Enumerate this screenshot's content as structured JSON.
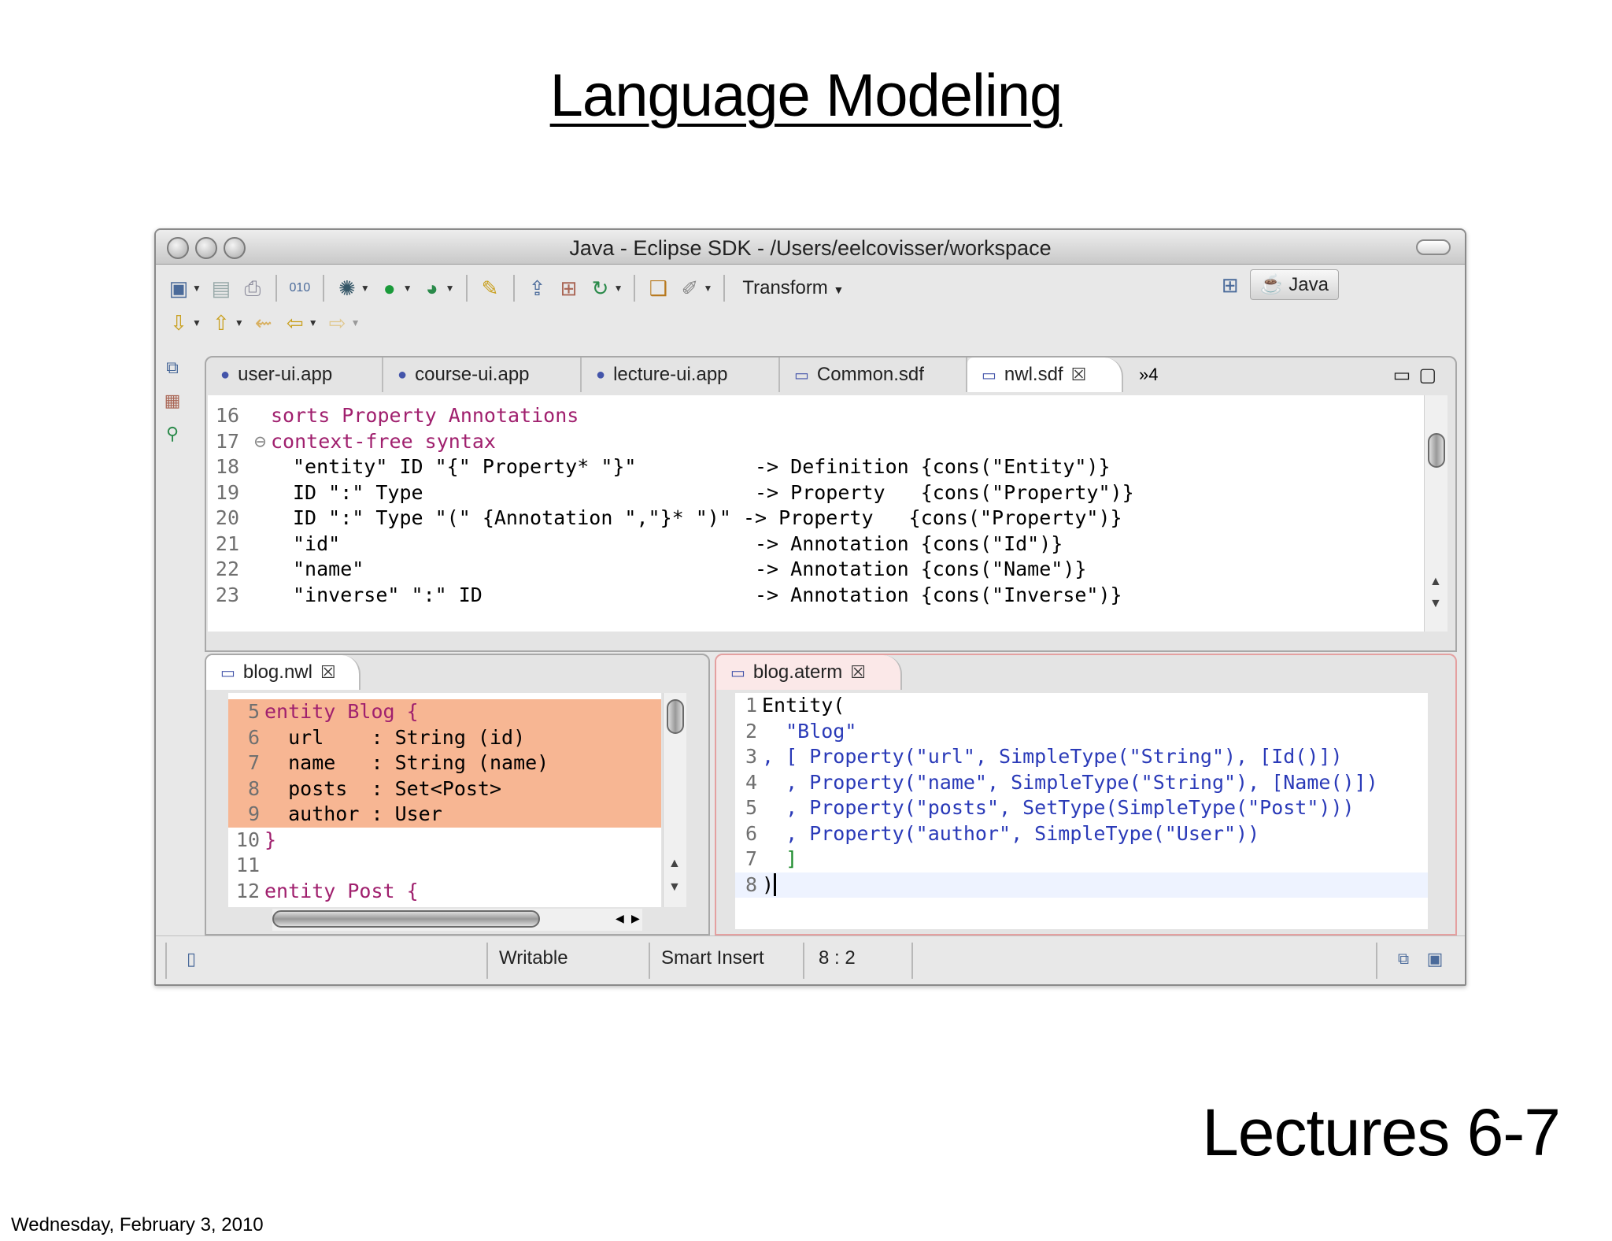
{
  "slide": {
    "title": "Language Modeling",
    "footer": "Lectures 6-7",
    "date": "Wednesday, February 3, 2010"
  },
  "window": {
    "title": "Java - Eclipse SDK - /Users/eelcovisser/workspace"
  },
  "toolbar": {
    "transform_label": "Transform",
    "perspective_label": "Java"
  },
  "top_editor": {
    "tabs": [
      {
        "label": "user-ui.app",
        "icon": "app-file-icon"
      },
      {
        "label": "course-ui.app",
        "icon": "app-file-icon"
      },
      {
        "label": "lecture-ui.app",
        "icon": "app-file-icon"
      },
      {
        "label": "Common.sdf",
        "icon": "sdf-file-icon"
      },
      {
        "label": "nwl.sdf",
        "icon": "sdf-file-icon"
      }
    ],
    "overflow": "»4",
    "lines": [
      {
        "n": "16",
        "text": "sorts Property Annotations"
      },
      {
        "n": "17",
        "text": "context-free syntax"
      },
      {
        "n": "18",
        "text": "\"entity\" ID \"{\" Property* \"}\"          -> Definition {cons(\"Entity\")}"
      },
      {
        "n": "19",
        "text": "ID \":\" Type                            -> Property   {cons(\"Property\")}"
      },
      {
        "n": "20",
        "text": "ID \":\" Type \"(\" {Annotation \",\"}* \")\" -> Property   {cons(\"Property\")}"
      },
      {
        "n": "21",
        "text": "\"id\"                                   -> Annotation {cons(\"Id\")}"
      },
      {
        "n": "22",
        "text": "\"name\"                                 -> Annotation {cons(\"Name\")}"
      },
      {
        "n": "23",
        "text": "\"inverse\" \":\" ID                       -> Annotation {cons(\"Inverse\")}"
      }
    ]
  },
  "left_editor": {
    "tab": "blog.nwl",
    "lines": [
      {
        "n": "5",
        "text": "entity Blog {"
      },
      {
        "n": "6",
        "text": "  url    : String (id)"
      },
      {
        "n": "7",
        "text": "  name   : String (name)"
      },
      {
        "n": "8",
        "text": "  posts  : Set<Post>"
      },
      {
        "n": "9",
        "text": "  author : User"
      },
      {
        "n": "10",
        "text": "}"
      },
      {
        "n": "11",
        "text": ""
      },
      {
        "n": "12",
        "text": "entity Post {"
      }
    ]
  },
  "right_editor": {
    "tab": "blog.aterm",
    "lines": [
      {
        "n": "1",
        "text": "Entity("
      },
      {
        "n": "2",
        "text": "  \"Blog\""
      },
      {
        "n": "3",
        "text": ", [ Property(\"url\", SimpleType(\"String\"), [Id()])"
      },
      {
        "n": "4",
        "text": "  , Property(\"name\", SimpleType(\"String\"), [Name()])"
      },
      {
        "n": "5",
        "text": "  , Property(\"posts\", SetType(SimpleType(\"Post\")))"
      },
      {
        "n": "6",
        "text": "  , Property(\"author\", SimpleType(\"User\"))"
      },
      {
        "n": "7",
        "text": "  ]"
      },
      {
        "n": "8",
        "text": ")"
      }
    ]
  },
  "status": {
    "writable": "Writable",
    "insert_mode": "Smart Insert",
    "position": "8 : 2"
  }
}
